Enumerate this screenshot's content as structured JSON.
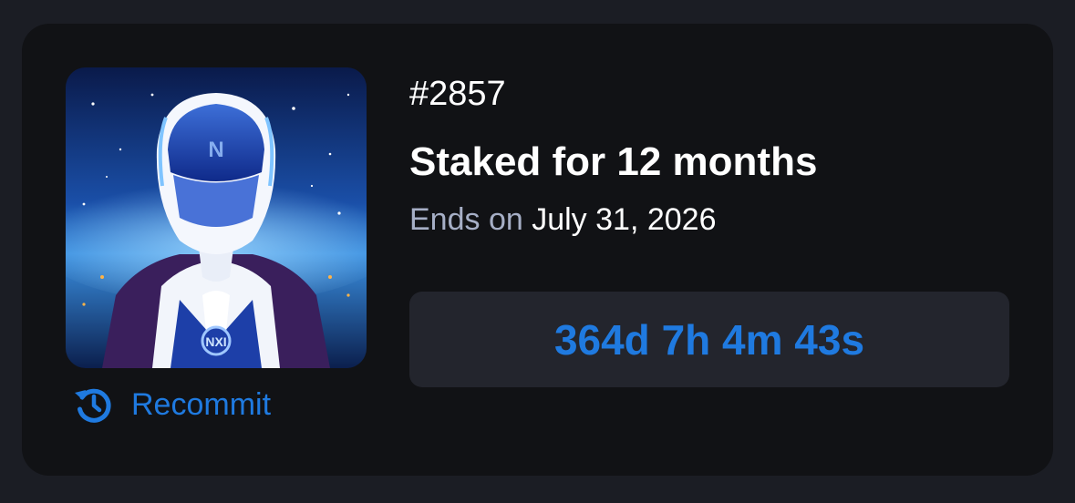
{
  "token": {
    "id": "#2857"
  },
  "stake": {
    "title": "Staked for 12 months",
    "ends_prefix": "Ends on",
    "ends_date": "July 31, 2026",
    "countdown": "364d 7h 4m 43s"
  },
  "actions": {
    "recommit_label": "Recommit",
    "recommit_icon": "history-icon"
  },
  "nft": {
    "image_alt": "futuristic helmeted figure in blue and white armor",
    "badge_text": "NXI"
  },
  "colors": {
    "accent": "#1f7ae0",
    "page_bg": "#1b1d24",
    "card_bg": "#111215",
    "countdown_bg": "#23252d",
    "muted_text": "#a6afc6"
  }
}
